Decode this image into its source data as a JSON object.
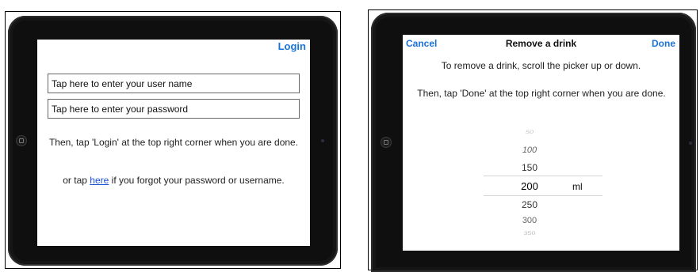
{
  "login_screen": {
    "login_label": "Login",
    "username_placeholder": "Tap here to enter your user name",
    "password_placeholder": "Tap here to enter your password",
    "instruction": "Then, tap 'Login' at the top right corner when you are done.",
    "forgot_prefix": "or tap ",
    "forgot_link": "here",
    "forgot_suffix": " if you forgot your password or username."
  },
  "remove_screen": {
    "cancel_label": "Cancel",
    "title": "Remove a drink",
    "done_label": "Done",
    "instruction_1": "To remove a drink, scroll the picker up or down.",
    "instruction_2": "Then, tap 'Done' at the top right corner when you are done.",
    "picker_values": [
      "50",
      "100",
      "150",
      "200",
      "250",
      "300",
      "350"
    ],
    "picker_selected": "200",
    "picker_unit": "ml"
  },
  "colors": {
    "link_blue": "#1a73d9",
    "device_bezel": "#0f0f0f"
  }
}
